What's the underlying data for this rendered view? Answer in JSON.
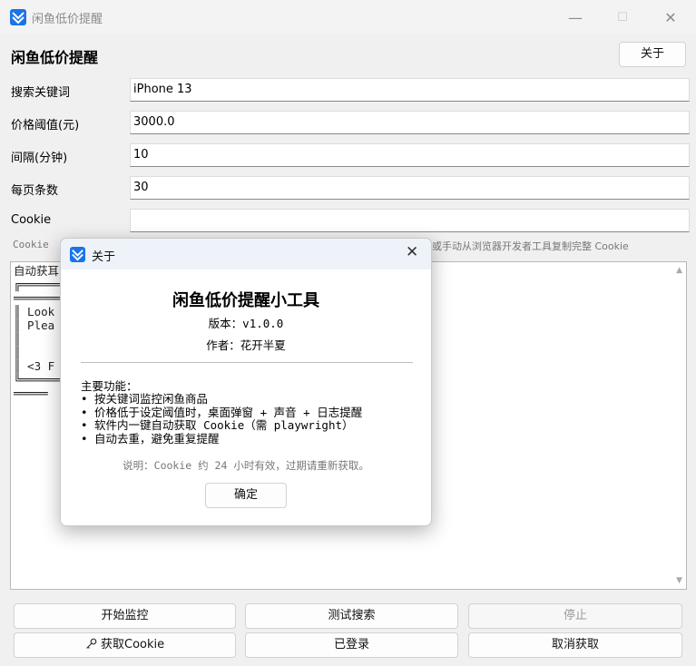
{
  "window": {
    "title": "闲鱼低价提醒",
    "minimize_icon": "—",
    "maximize_icon": "☐",
    "close_icon": "✕"
  },
  "header": {
    "title": "闲鱼低价提醒",
    "about_button": "关于"
  },
  "form": {
    "keyword": {
      "label": "搜索关键词",
      "value": "iPhone 13"
    },
    "price": {
      "label": "价格阈值(元)",
      "value": "3000.0"
    },
    "interval": {
      "label": "间隔(分钟)",
      "value": "10"
    },
    "page_size": {
      "label": "每页条数",
      "value": "30"
    },
    "cookie": {
      "label": "Cookie",
      "value": ""
    }
  },
  "hint": {
    "left": "Cookie",
    "right": "或手动从浏览器开发者工具复制完整 Cookie"
  },
  "log": {
    "lines": [
      "自动获耳",
      "╔══════════════════════════════════════════════════",
      "══════════════════════════════════════════════════",
      "║ Look                                                    ║",
      "║ Plea                                            ers:     ║",
      "║                                                          ║",
      "║                                                          ║",
      "║ <3 F                                                     ║",
      "╚════════════════════════════════════════════════════════",
      "═════"
    ]
  },
  "buttons": {
    "start": "开始监控",
    "test": "测试搜索",
    "stop": "停止",
    "get_cookie": "获取Cookie",
    "logged_in": "已登录",
    "cancel": "取消获取"
  },
  "dialog": {
    "title": "关于",
    "close_icon": "✕",
    "heading": "闲鱼低价提醒小工具",
    "version": "版本：v1.0.0",
    "author": "作者：花开半夏",
    "features_title": "主要功能：",
    "features": [
      "• 按关键词监控闲鱼商品",
      "• 价格低于设定阈值时，桌面弹窗 + 声音 + 日志提醒",
      "• 软件内一键自动获取 Cookie（需 playwright）",
      "• 自动去重，避免重复提醒"
    ],
    "note": "说明：Cookie 约 24 小时有效，过期请重新获取。",
    "ok_button": "确定"
  }
}
